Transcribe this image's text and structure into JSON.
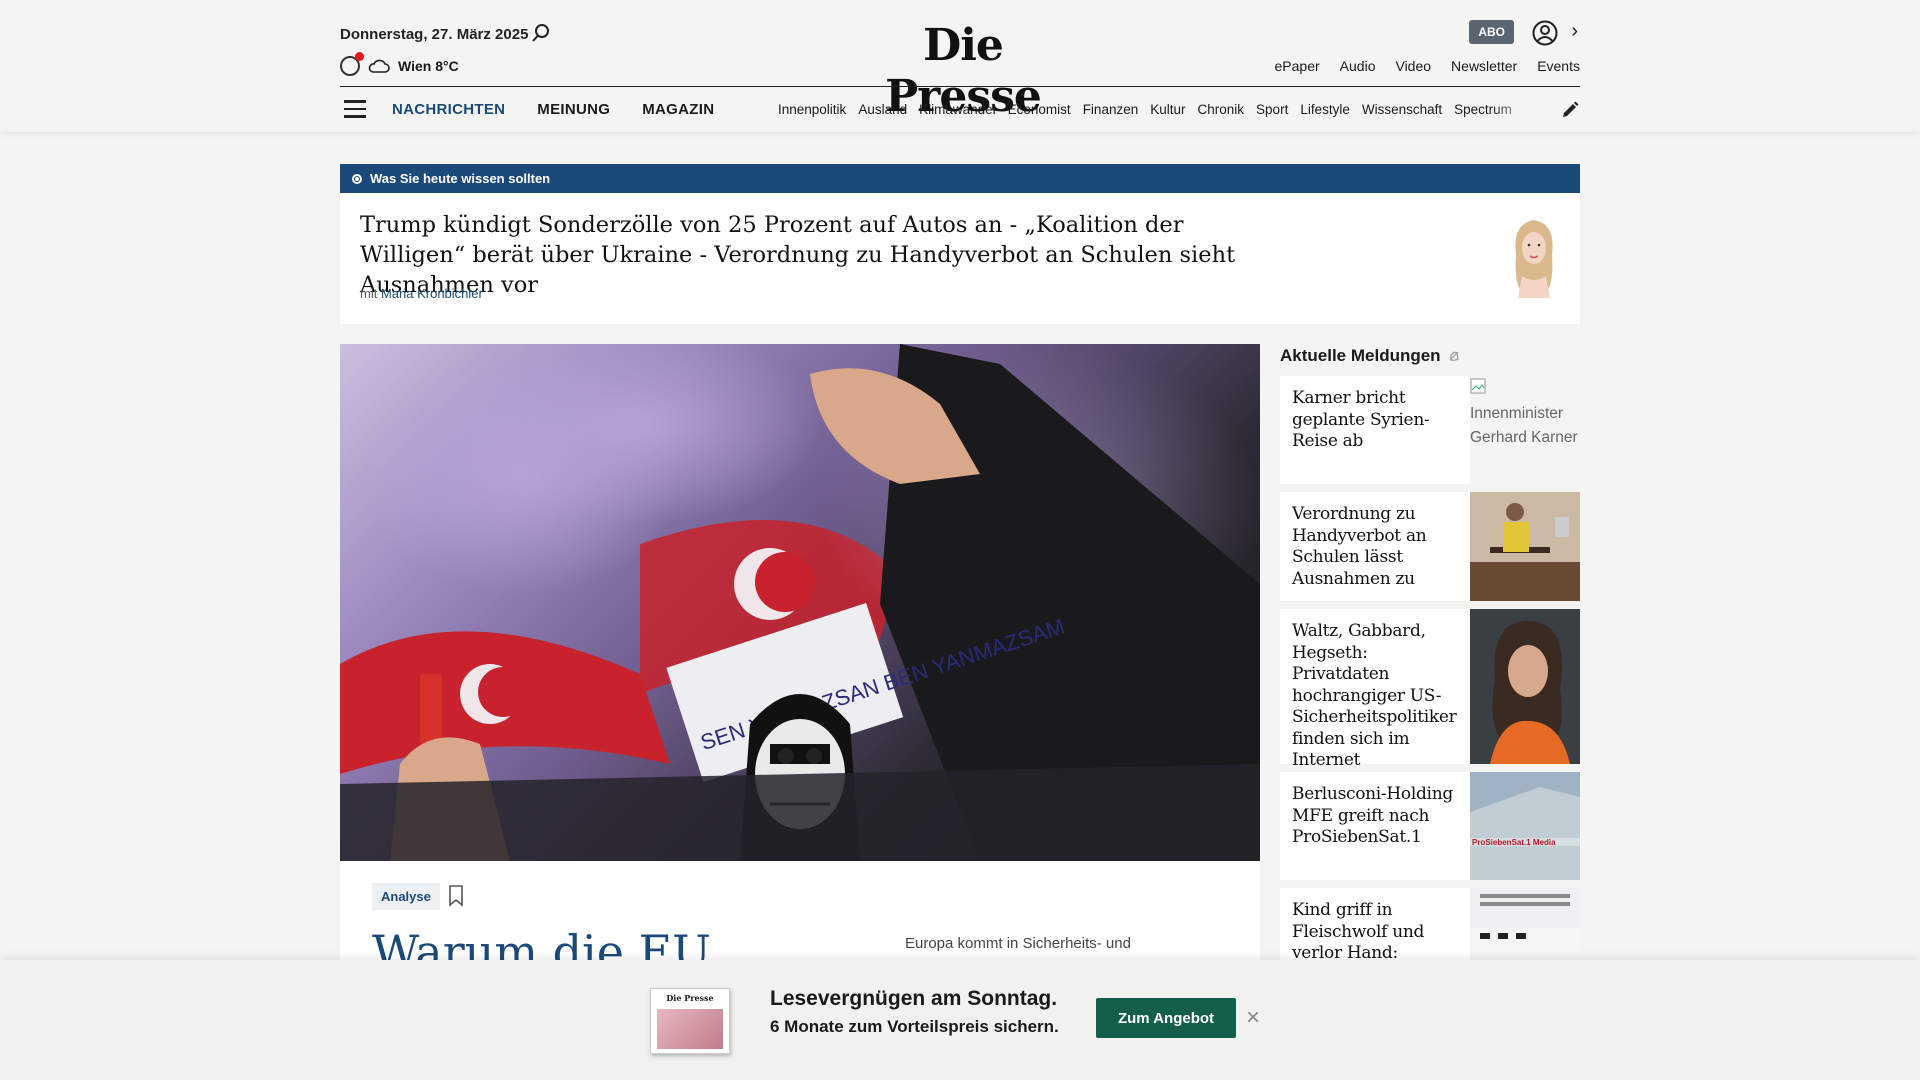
{
  "header": {
    "date": "Donnerstag, 27. März 2025",
    "weather": "Wien 8°C",
    "logo": "Die Presse",
    "abo_label": "ABO",
    "top_links": [
      "ePaper",
      "Audio",
      "Video",
      "Newsletter",
      "Events"
    ],
    "main_nav": [
      "NACHRICHTEN",
      "MEINUNG",
      "MAGAZIN"
    ],
    "sub_nav": [
      "Innenpolitik",
      "Ausland",
      "Klimawandel",
      "Economist",
      "Finanzen",
      "Kultur",
      "Chronik",
      "Sport",
      "Lifestyle",
      "Wissenschaft",
      "Spectrum"
    ],
    "active_color": "#1b4a7a"
  },
  "briefing": {
    "bar_label": "Was Sie heute wissen sollten",
    "headline": "Trump kündigt Sonderzölle von 25 Prozent auf Autos an - „Koalition der Willigen“ berät über Ukraine - Verordnung zu Handyverbot an Schulen sieht Ausnahmen vor",
    "author_prefix": "mit",
    "author_name": "Maria Kronbichler"
  },
  "hero": {
    "tag": "Analyse",
    "title": "Warum die EU",
    "teaser": "Europa kommt in Sicherheits- und",
    "sign_text": "SEN YANMAZSAN BEN YANMAZSAM"
  },
  "sidebar": {
    "title": "Aktuelle Meldungen",
    "items": [
      {
        "text": "Karner bricht geplante Syrien-Reise ab",
        "image_alt": "Innenminister Gerhard Karner"
      },
      {
        "text": "Verordnung zu Handyverbot an Schulen lässt Ausnahmen zu"
      },
      {
        "text": "Waltz, Gabbard, Hegseth: Privatdaten hochrangiger US-Sicherheitspolitiker finden sich im Internet"
      },
      {
        "text": "Berlusconi-Holding MFE greift nach ProSiebenSat.1",
        "image_text": "ProSiebenSat.1 Media"
      },
      {
        "text": "Kind griff in Fleischwolf und verlor Hand: Prozess"
      }
    ]
  },
  "promo": {
    "headline": "Lesevergnügen am Sonntag.",
    "subline": "6 Monate zum Vorteilspreis sichern.",
    "button": "Zum Angebot",
    "cover_title": "Die Presse",
    "button_color": "#145f4c"
  }
}
